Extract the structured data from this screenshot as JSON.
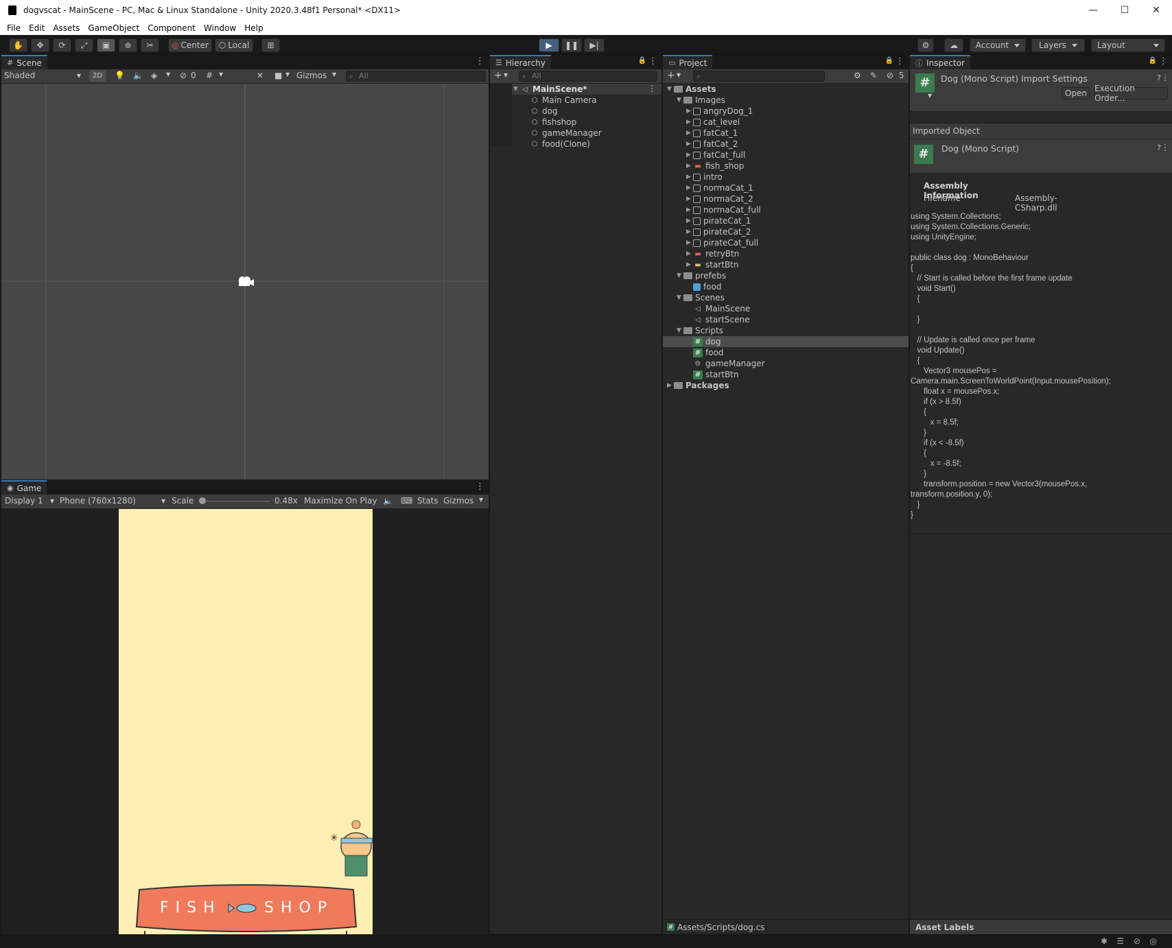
{
  "window": {
    "title": "dogvscat - MainScene - PC, Mac & Linux Standalone - Unity 2020.3.48f1 Personal* <DX11>",
    "minimize": "—",
    "maximize": "☐",
    "close": "✕"
  },
  "menu": [
    "File",
    "Edit",
    "Assets",
    "GameObject",
    "Component",
    "Window",
    "Help"
  ],
  "toolbar": {
    "center": "Center",
    "local": "Local",
    "account": "Account",
    "layers": "Layers",
    "layout": "Layout"
  },
  "scene": {
    "tab": "Scene",
    "shading": "Shaded",
    "mode_2d": "2D",
    "hidden_count": "0",
    "gizmos": "Gizmos",
    "search_placeholder": "All"
  },
  "game": {
    "tab": "Game",
    "display": "Display 1",
    "resolution": "Phone (760x1280)",
    "scale_label": "Scale",
    "scale_value": "0.48x",
    "maximize": "Maximize On Play",
    "stats": "Stats",
    "gizmos": "Gizmos",
    "sign_left": "FISH",
    "sign_right": "SHOP"
  },
  "hierarchy": {
    "tab": "Hierarchy",
    "search_placeholder": "All",
    "scene": "MainScene*",
    "objects": [
      "Main Camera",
      "dog",
      "fishshop",
      "gameManager",
      "food(Clone)"
    ]
  },
  "project": {
    "tab": "Project",
    "hidden_count": "5",
    "assets_label": "Assets",
    "images_label": "Images",
    "images": [
      "angryDog_1",
      "cat_level",
      "fatCat_1",
      "fatCat_2",
      "fatCat_full",
      "fish_shop",
      "intro",
      "normaCat_1",
      "normaCat_2",
      "normaCat_full",
      "pirateCat_1",
      "pirateCat_2",
      "pirateCat_full",
      "retryBtn",
      "startBtn"
    ],
    "prefabs_label": "prefebs",
    "prefabs": [
      "food"
    ],
    "scenes_label": "Scenes",
    "scenes": [
      "MainScene",
      "startScene"
    ],
    "scripts_label": "Scripts",
    "scripts": [
      "dog",
      "food",
      "gameManager",
      "startBtn"
    ],
    "packages_label": "Packages",
    "path": "Assets/Scripts/dog.cs"
  },
  "inspector": {
    "tab": "Inspector",
    "header_title": "Dog (Mono Script) Import Settings",
    "open_btn": "Open",
    "exec_btn": "Execution Order...",
    "imported_object": "Imported Object",
    "object_name": "Dog (Mono Script)",
    "assembly_info": "Assembly Information",
    "filename_label": "Filename",
    "filename_value": "Assembly-CSharp.dll",
    "code": "using System.Collections;\nusing System.Collections.Generic;\nusing UnityEngine;\n\npublic class dog : MonoBehaviour\n{\n   // Start is called before the first frame update\n   void Start()\n   {\n\n   }\n\n   // Update is called once per frame\n   void Update()\n   {\n      Vector3 mousePos =\nCamera.main.ScreenToWorldPoint(Input.mousePosition);\n      float x = mousePos.x;\n      if (x > 8.5f)\n      {\n         x = 8.5f;\n      }\n      if (x < -8.5f)\n      {\n         x = -8.5f;\n      }\n      transform.position = new Vector3(mousePos.x,\ntransform.position.y, 0);\n   }\n}",
    "asset_labels": "Asset Labels"
  },
  "colors": {
    "play_active": "#46607c",
    "game_bg": "#ffefb3",
    "shop_red": "#f07a5c"
  }
}
